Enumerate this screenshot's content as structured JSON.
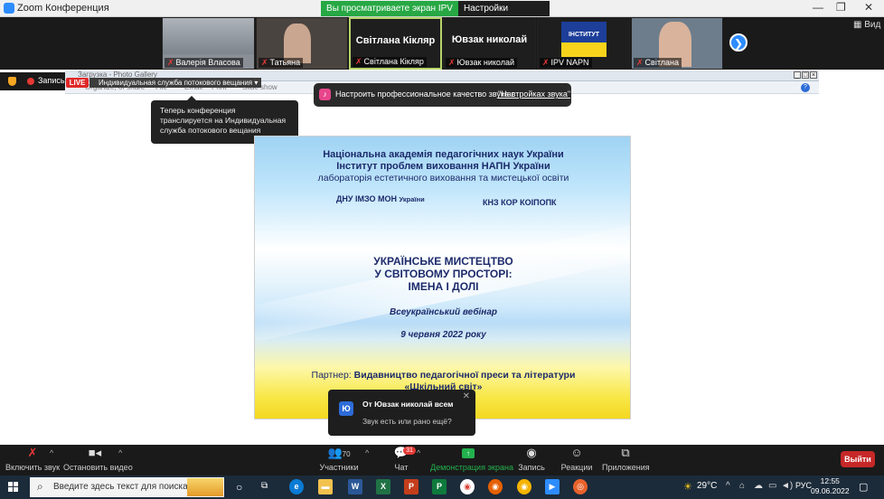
{
  "window": {
    "title": "Zoom Конференция",
    "controls": [
      "—",
      "❐",
      "✕"
    ]
  },
  "view_banner": {
    "viewing_text": "Вы просматриваете экран IPV NAPN",
    "view_options": "Настройки просмотра ▾"
  },
  "filmstrip": {
    "participants": [
      {
        "name": "Валерія Власова"
      },
      {
        "name": "Татьяна"
      },
      {
        "name": "Світлана Кікляр",
        "display": "Світлана Кікляр"
      },
      {
        "name": "Ювзак николай",
        "display": "Ювзак николай"
      },
      {
        "name": "IPV NAPN",
        "logo_text": "ІНСТИТУТ"
      },
      {
        "name": "Світлана"
      }
    ],
    "view_label": "Вид",
    "next_arrow": "❯"
  },
  "recording": {
    "label": "Запись"
  },
  "inner_window": {
    "title": "Загрузка - Photo Gallery",
    "menu": [
      "Organize, or share",
      "File",
      "Email",
      "Print",
      "Slide show"
    ]
  },
  "live": {
    "badge": "LIVE",
    "service": "Индивидуальная служба потокового вещания ▾",
    "tooltip": "Теперь конференция транслируется на Индивидуальная служба потокового вещания"
  },
  "audio_tip": {
    "text": "Настроить профессиональное качество звука в",
    "link": "\"Настройках звука\""
  },
  "slide": {
    "line1": "Національна академія педагогічних наук України",
    "line2": "Інститут проблем виховання НАПН України",
    "line3": "лабораторія естетичного виховання та мистецької освіти",
    "org_left": "ДНУ ІМЗО МОН",
    "org_left_small": "України",
    "org_right": "КНЗ КОР КОІПОПК",
    "title1": "УКРАЇНСЬКЕ МИСТЕЦТВО",
    "title2": "У СВІТОВОМУ ПРОСТОРІ:",
    "title3": "ІМЕНА І ДОЛІ",
    "event": "Всеукраїнський вебінар",
    "date": "9 червня 2022 року",
    "partner_label": "Партнер:",
    "partner_name": "Видавництво педагогічної преси та літератури",
    "partner_name2": "«Шкільний світ»"
  },
  "chat_toast": {
    "avatar": "Ю",
    "from": "От Ювзак николай всем",
    "message": "Звук есть или рано ещё?"
  },
  "toolbar": {
    "mute_label": "Включить звук",
    "video_label": "Остановить видео",
    "participants_label": "Участники",
    "participants_count": "70",
    "chat_label": "Чат",
    "chat_badge": "31",
    "share_label": "Демонстрация экрана",
    "record_label": "Запись",
    "reactions_label": "Реакции",
    "apps_label": "Приложения",
    "exit_label": "Выйти"
  },
  "taskbar": {
    "search_placeholder": "Введите здесь текст для поиска",
    "weather": "29°C",
    "lang": "РУС",
    "time": "12:55",
    "date": "09.06.2022",
    "apps": [
      "W",
      "X",
      "P",
      "P"
    ]
  }
}
